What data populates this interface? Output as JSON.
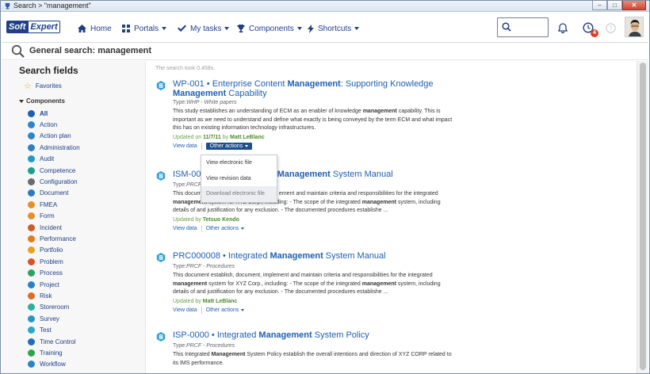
{
  "window": {
    "title": "Search > \"management\""
  },
  "nav": {
    "logo_soft": "Soft",
    "logo_expert": "Expert",
    "items": [
      {
        "label": "Home",
        "icon": "home-icon"
      },
      {
        "label": "Portals",
        "icon": "portals-icon"
      },
      {
        "label": "My tasks",
        "icon": "check-icon"
      },
      {
        "label": "Components",
        "icon": "trophy-icon"
      },
      {
        "label": "Shortcuts",
        "icon": "bolt-icon"
      }
    ],
    "search_placeholder": "",
    "badge_count": "4"
  },
  "header": {
    "title": "General search: management"
  },
  "sidebar": {
    "title": "Search fields",
    "favorites": "Favorites",
    "components_label": "Components",
    "items": [
      {
        "label": "All",
        "color": "#1f5fb0",
        "bold": true
      },
      {
        "label": "Action",
        "color": "#2d86c8"
      },
      {
        "label": "Action plan",
        "color": "#2d86c8"
      },
      {
        "label": "Administration",
        "color": "#2e7fc4"
      },
      {
        "label": "Audit",
        "color": "#1f9bc8"
      },
      {
        "label": "Competence",
        "color": "#1aa08c"
      },
      {
        "label": "Configuration",
        "color": "#6b6b6b"
      },
      {
        "label": "Document",
        "color": "#2e79c6"
      },
      {
        "label": "FMEA",
        "color": "#e4902a"
      },
      {
        "label": "Form",
        "color": "#e4902a"
      },
      {
        "label": "Incident",
        "color": "#d05a2a"
      },
      {
        "label": "Performance",
        "color": "#e07b22"
      },
      {
        "label": "Portfolio",
        "color": "#e3a22a"
      },
      {
        "label": "Problem",
        "color": "#d9522b"
      },
      {
        "label": "Process",
        "color": "#2aa06b"
      },
      {
        "label": "Project",
        "color": "#2b7fc5"
      },
      {
        "label": "Risk",
        "color": "#e06a2a"
      },
      {
        "label": "Storeroom",
        "color": "#2bb0a0"
      },
      {
        "label": "Survey",
        "color": "#2a93c9"
      },
      {
        "label": "Test",
        "color": "#2aa9c2"
      },
      {
        "label": "Time Control",
        "color": "#1e6fc0"
      },
      {
        "label": "Training",
        "color": "#2ba64d"
      },
      {
        "label": "Workflow",
        "color": "#2a85c7"
      }
    ]
  },
  "main": {
    "took": "The search took 0.458s.",
    "results": [
      {
        "title_parts": [
          "WP-001 • Enterprise Content ",
          "Management",
          ": Supporting Knowledge ",
          "Management",
          " Capability"
        ],
        "type_prefix": "Type:",
        "type": "WHP - White papers",
        "desc_parts": [
          "This study establishes an understanding of ECM as an enabler of knowledge ",
          "management",
          " capability. This is important as we need to understand and define what exactly is being conveyed by the term ECM and what impact this has on existing information technology infrastructures."
        ],
        "updated_prefix": "Updated on ",
        "updated_date": "11/7/11",
        "updated_by_prefix": " by ",
        "updated_by": "Matt LeBlanc",
        "view": "View data",
        "other": "Other actions"
      },
      {
        "title_parts": [
          "ISM-000",
          "",
          "",
          "Management",
          " System Manual"
        ],
        "type_prefix": "Type:",
        "type": "PRCF",
        "desc_parts": [
          "This document",
          "",
          "",
          "ement and maintain criteria and responsibilities for the integrated ",
          "management",
          " system for XYZ Corp., including: - The scope of the integrated ",
          "management",
          " system, including details of and justification for any exclusion. - The documented procedures establishe ..."
        ],
        "updated_prefix": "Updated by ",
        "updated_by": "Tetsuo Kendo",
        "view": "View data",
        "other": "Other actions"
      },
      {
        "title_parts": [
          "PRC000008 • Integrated ",
          "Management",
          " System Manual"
        ],
        "type_prefix": "Type:",
        "type": "PRCF - Procedures",
        "desc_parts": [
          "This document establish, document, implement and maintain criteria and responsibilities for the integrated ",
          "management",
          " system for XYZ Corp., including: - The scope of the integrated ",
          "management",
          " system, including details of and justification for any exclusion. - The documented procedures establishe ..."
        ],
        "updated_prefix": "Updated by ",
        "updated_by": "Matt LeBlanc",
        "view": "View data",
        "other": "Other actions"
      },
      {
        "title_parts": [
          "ISP-0000 • Integrated ",
          "Management",
          " System Policy"
        ],
        "type_prefix": "Type:",
        "type": "PRCF - Procedures",
        "desc_parts": [
          "This Integrated ",
          "Management",
          " System Policy establish the overall intentions and direction of XYZ CORP related to its IMS performance."
        ]
      }
    ],
    "dropdown": [
      "View electronic file",
      "View revision data",
      "Download electronic file"
    ]
  }
}
